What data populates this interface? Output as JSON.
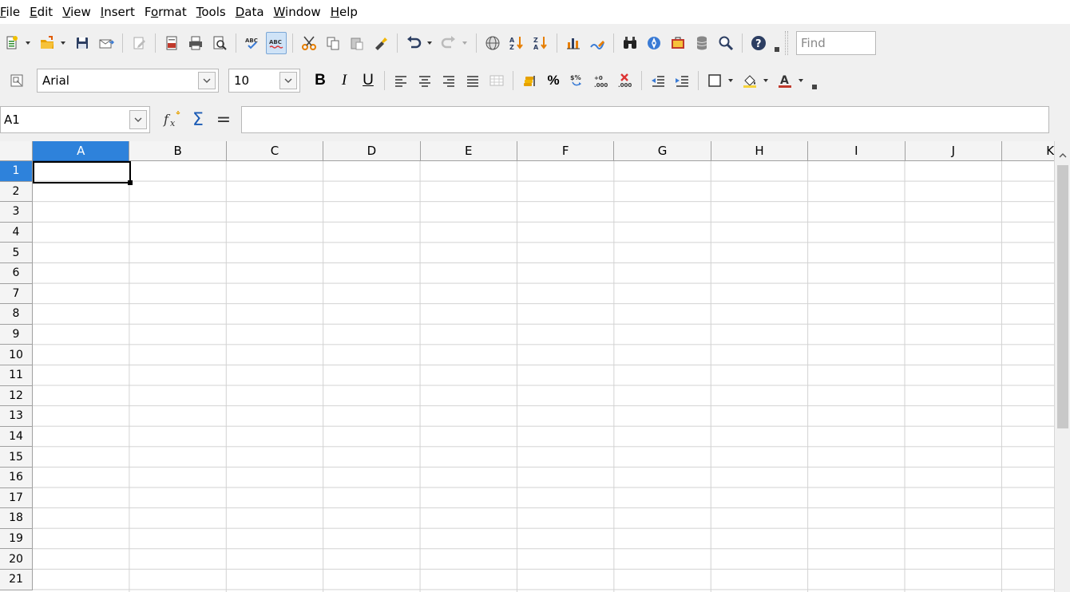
{
  "menu": [
    {
      "key": "file",
      "pre": "",
      "u": "F",
      "post": "ile"
    },
    {
      "key": "edit",
      "pre": "",
      "u": "E",
      "post": "dit"
    },
    {
      "key": "view",
      "pre": "",
      "u": "V",
      "post": "iew"
    },
    {
      "key": "insert",
      "pre": "",
      "u": "I",
      "post": "nsert"
    },
    {
      "key": "format",
      "pre": "F",
      "u": "o",
      "post": "rmat"
    },
    {
      "key": "tools",
      "pre": "",
      "u": "T",
      "post": "ools"
    },
    {
      "key": "data",
      "pre": "",
      "u": "D",
      "post": "ata"
    },
    {
      "key": "window",
      "pre": "",
      "u": "W",
      "post": "indow"
    },
    {
      "key": "help",
      "pre": "",
      "u": "H",
      "post": "elp"
    }
  ],
  "find": {
    "placeholder": "Find"
  },
  "formatting": {
    "font_name": "Arial",
    "font_size": "10",
    "bold": "B",
    "italic": "I",
    "underline": "U",
    "percent": "%"
  },
  "formula_bar": {
    "name_box": "A1",
    "sum_symbol": "Σ",
    "equals_symbol": "=",
    "formula": ""
  },
  "sheet": {
    "columns": [
      "A",
      "B",
      "C",
      "D",
      "E",
      "F",
      "G",
      "H",
      "I",
      "J",
      "K"
    ],
    "rows": [
      "1",
      "2",
      "3",
      "4",
      "5",
      "6",
      "7",
      "8",
      "9",
      "10",
      "11",
      "12",
      "13",
      "14",
      "15",
      "16",
      "17",
      "18",
      "19",
      "20",
      "21"
    ],
    "active_column": "A",
    "active_row": "1"
  },
  "colors": {
    "accent": "#2e82db",
    "gridline": "#d2d2d2",
    "header_bg": "#f4f4f4"
  }
}
